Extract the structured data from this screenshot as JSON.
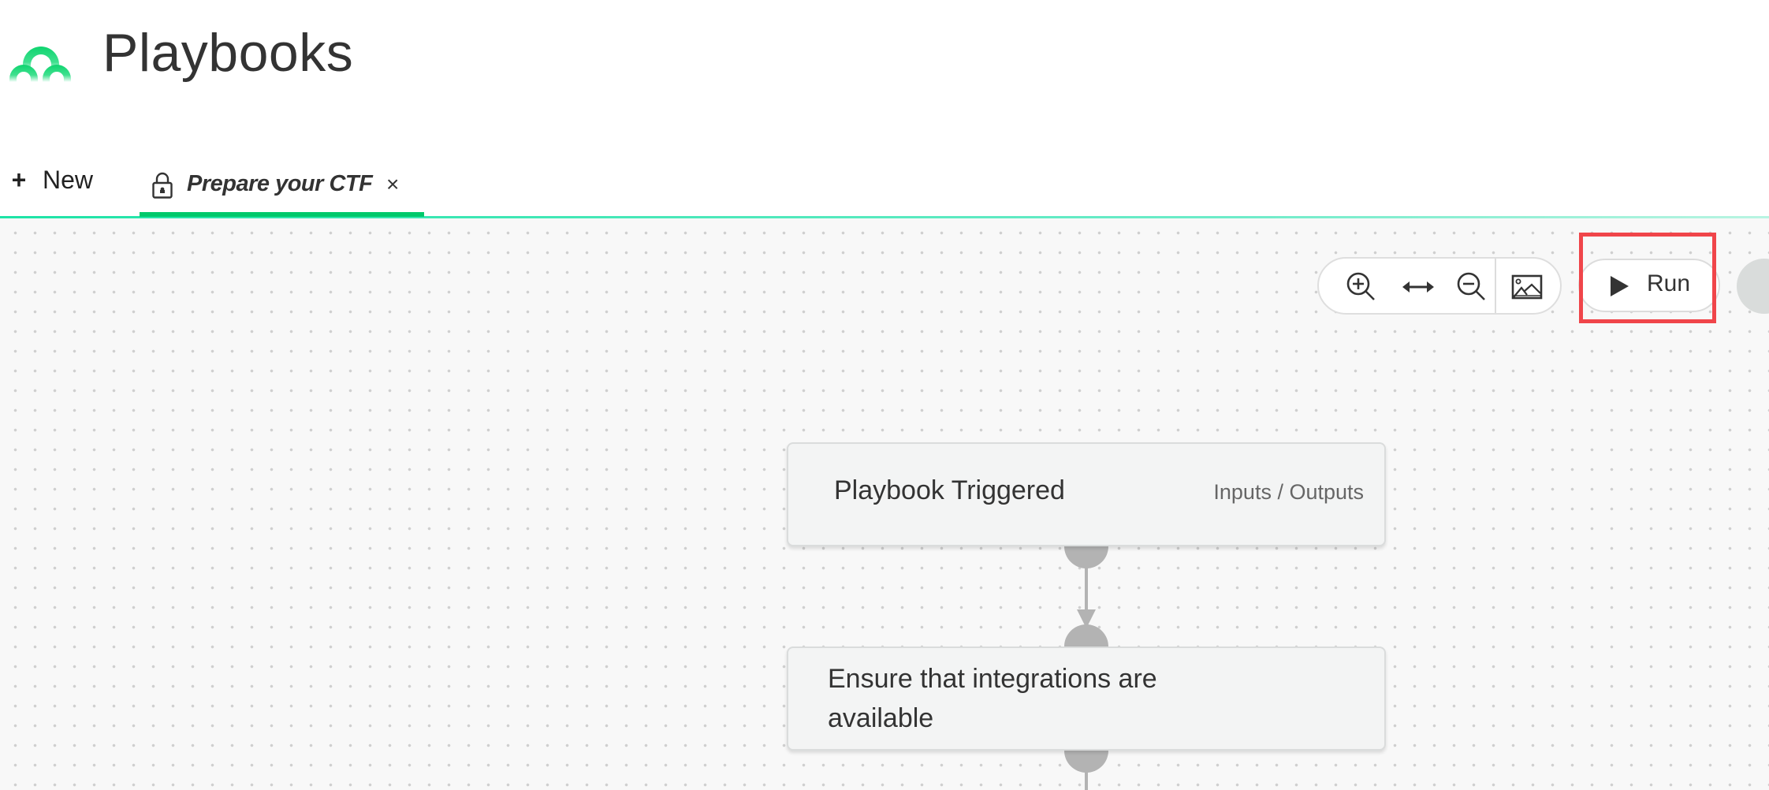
{
  "header": {
    "title": "Playbooks",
    "logo": "app-logo-arches",
    "brand_color": "#00cc66"
  },
  "tabs": {
    "new_label": "New",
    "new_icon": "plus-icon",
    "items": [
      {
        "label": "Prepare your CTF",
        "icon": "lock-icon",
        "active": true,
        "close_glyph": "×"
      }
    ],
    "active_color": "#00c96b"
  },
  "toolbar": {
    "zoom_in": "zoom-in-icon",
    "fit": "fit-width-icon",
    "zoom_out": "zoom-out-icon",
    "export_image": "image-icon"
  },
  "run": {
    "label": "Run",
    "icon": "play-icon",
    "highlight_color": "#f0454a"
  },
  "flow": {
    "nodes": [
      {
        "title": "Playbook Triggered",
        "link": "Inputs / Outputs"
      },
      {
        "title": "Ensure that integrations are available"
      }
    ],
    "connector_color": "#b3b3b3"
  }
}
